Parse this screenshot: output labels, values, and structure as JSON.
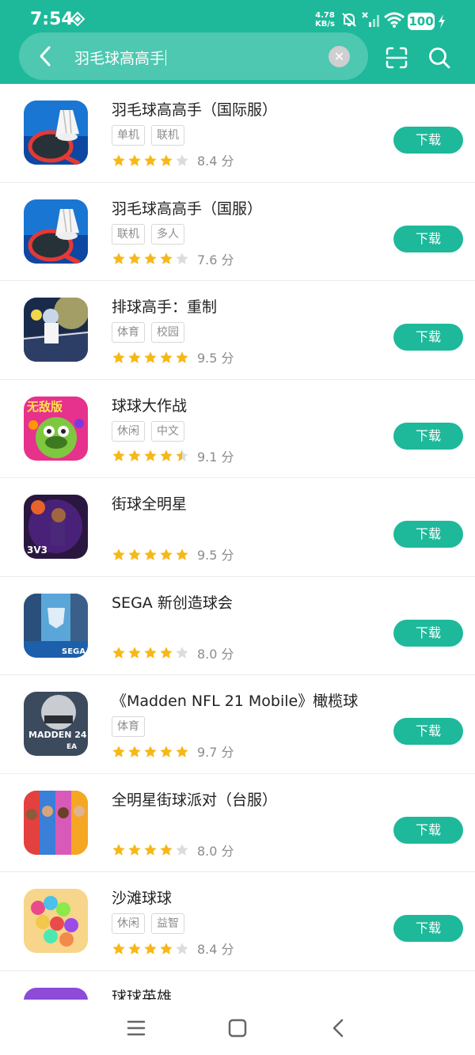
{
  "status": {
    "time": "7:54",
    "speed_value": "4.78",
    "speed_unit": "KB/s",
    "battery": "100"
  },
  "search": {
    "query": "羽毛球高高手"
  },
  "apps": [
    {
      "name": "羽毛球高高手（国际服）",
      "tags": [
        "单机",
        "联机"
      ],
      "stars": 4,
      "score": "8.4 分",
      "button": "下载",
      "icon": "badminton"
    },
    {
      "name": "羽毛球高高手（国服）",
      "tags": [
        "联机",
        "多人"
      ],
      "stars": 4,
      "score": "7.6 分",
      "button": "下载",
      "icon": "badminton"
    },
    {
      "name": "排球高手：重制",
      "tags": [
        "体育",
        "校园"
      ],
      "stars": 5,
      "score": "9.5 分",
      "button": "下载",
      "icon": "volleyball"
    },
    {
      "name": "球球大作战",
      "tags": [
        "休闲",
        "中文"
      ],
      "stars": 4.5,
      "score": "9.1 分",
      "button": "下载",
      "icon": "ballwar",
      "icon_text": "无敌版"
    },
    {
      "name": "街球全明星",
      "tags": [],
      "stars": 5,
      "score": "9.5 分",
      "button": "下载",
      "icon": "basketball",
      "icon_text": "3V3"
    },
    {
      "name": "SEGA 新创造球会",
      "tags": [],
      "stars": 4,
      "score": "8.0 分",
      "button": "下载",
      "icon": "sega",
      "icon_text": "SEGA"
    },
    {
      "name": "《Madden NFL 21 Mobile》橄榄球",
      "tags": [
        "体育"
      ],
      "stars": 5,
      "score": "9.7 分",
      "button": "下载",
      "icon": "madden",
      "icon_text": "MADDEN 24"
    },
    {
      "name": "全明星街球派对（台服）",
      "tags": [],
      "stars": 4,
      "score": "8.0 分",
      "button": "下载",
      "icon": "allstar"
    },
    {
      "name": "沙滩球球",
      "tags": [
        "休闲",
        "益智"
      ],
      "stars": 4,
      "score": "8.4 分",
      "button": "下载",
      "icon": "beachballs"
    },
    {
      "name": "球球英雄",
      "tags": [],
      "stars": 0,
      "score": "",
      "button": "",
      "icon": "hero"
    }
  ],
  "colors": {
    "accent": "#1db99a",
    "star": "#f7b817",
    "star_empty": "#dcdcdc"
  }
}
